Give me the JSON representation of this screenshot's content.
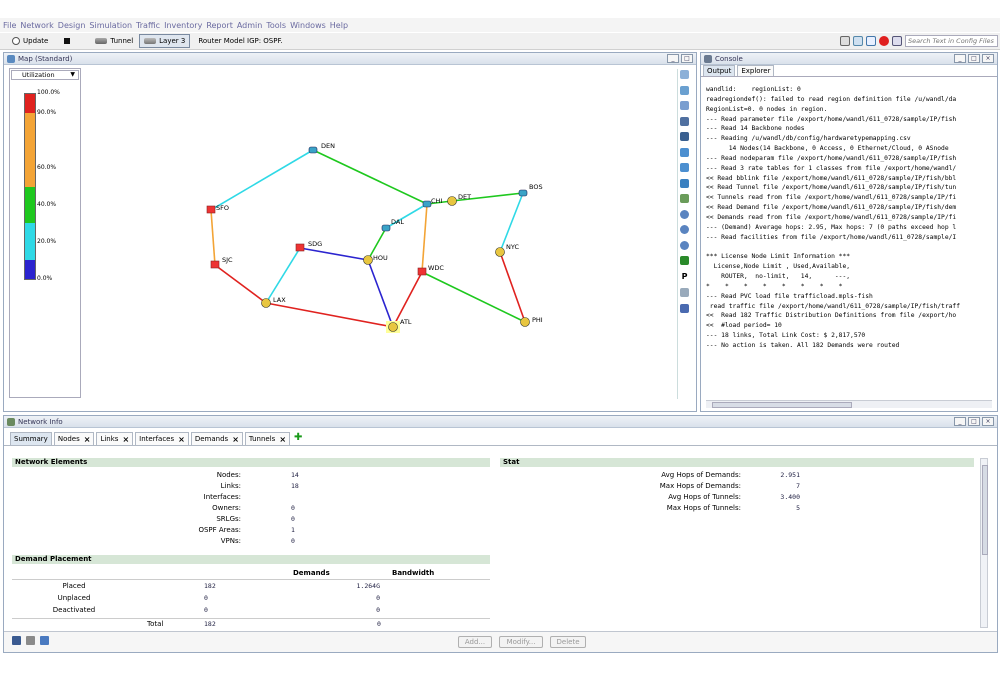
{
  "menu": [
    "File",
    "Network",
    "Design",
    "Simulation",
    "Traffic",
    "Inventory",
    "Report",
    "Admin",
    "Tools",
    "Windows",
    "Help"
  ],
  "toolbar": {
    "update": "Update",
    "tunnel": "Tunnel",
    "layer3": "Layer 3",
    "router_model": "Router Model IGP: OSPF.",
    "search_placeholder": "Search Text in Config Files"
  },
  "map": {
    "title": "Map (Standard)",
    "legend_select": "Utilization",
    "legend_ticks": [
      "100.0%",
      "90.0%",
      "60.0%",
      "40.0%",
      "20.0%",
      "0.0%"
    ],
    "nodes": {
      "DEN": "DEN",
      "SFO": "SFO",
      "SJC": "SJC",
      "LAX": "LAX",
      "SDG": "SDG",
      "HOU": "HOU",
      "DAL": "DAL",
      "CHI": "CHI",
      "DET": "DET",
      "BOS": "BOS",
      "NYC": "NYC",
      "WDC": "WDC",
      "ATL": "ATL",
      "PHI": "PHI"
    }
  },
  "console": {
    "title": "Console",
    "tabs": [
      "Output",
      "Explorer"
    ],
    "lines": [
      "wandlid:    regionList: 0",
      "readregiondef(): failed to read region definition file /u/wandl/da",
      "RegionList=0. 0 nodes in region.",
      "--- Read parameter file /export/home/wandl/611_0728/sample/IP/fish",
      "--- Read 14 Backbone nodes",
      "--- Reading /u/wandl/db/config/hardwaretypemapping.csv",
      "      14 Nodes(14 Backbone, 0 Access, 0 Ethernet/Cloud, 0 ASnode",
      "--- Read nodeparam file /export/home/wandl/611_0728/sample/IP/fish",
      "--- Read 3 rate tables for 1 classes from file /export/home/wandl/",
      "<< Read bblink file /export/home/wandl/611_0728/sample/IP/fish/bbl",
      "<< Read Tunnel file /export/home/wandl/611_0728/sample/IP/fish/tun",
      "<< Tunnels read from file /export/home/wandl/611_0728/sample/IP/fi",
      "<< Read Demand file /export/home/wandl/611_0728/sample/IP/fish/dem",
      "<< Demands read from file /export/home/wandl/611_0728/sample/IP/fi",
      "--- (Demand) Average hops: 2.95, Max hops: 7 (0 paths exceed hop l",
      "--- Read facilities from file /export/home/wandl/611_0728/sample/I",
      "",
      "*** License Node Limit Information ***",
      "  License,Node Limit , Used,Available,",
      "    ROUTER,  no-limit,   14,      ---,",
      "*    *    *    *    *    *    *    *",
      "--- Read PVC load file trafficload.mpls-fish",
      " read traffic file /export/home/wandl/611_0728/sample/IP/fish/traff",
      "<<  Read 182 Traffic Distribution Definitions from file /export/ho",
      "<<  #load period= 10",
      "--- 18 links, Total Link Cost: $ 2,817,570",
      "--- No action is taken. All 182 Demands were routed"
    ]
  },
  "network_info": {
    "title": "Network Info",
    "tabs": [
      "Summary",
      "Nodes",
      "Links",
      "Interfaces",
      "Demands",
      "Tunnels"
    ],
    "elements_title": "Network Elements",
    "elements": [
      {
        "label": "Nodes:",
        "value": "14"
      },
      {
        "label": "Links:",
        "value": "18"
      },
      {
        "label": "Interfaces:",
        "value": ""
      },
      {
        "label": "Owners:",
        "value": "0"
      },
      {
        "label": "SRLGs:",
        "value": "0"
      },
      {
        "label": "OSPF Areas:",
        "value": "1"
      },
      {
        "label": "VPNs:",
        "value": "0"
      }
    ],
    "stat_title": "Stat",
    "stats": [
      {
        "label": "Avg Hops of Demands:",
        "value": "2.951"
      },
      {
        "label": "Max Hops of Demands:",
        "value": "7"
      },
      {
        "label": "Avg Hops of Tunnels:",
        "value": "3.400"
      },
      {
        "label": "Max Hops of Tunnels:",
        "value": "5"
      }
    ],
    "placement_title": "Demand Placement",
    "placement_headers": [
      "Demands",
      "Bandwidth"
    ],
    "placement": [
      {
        "label": "Placed",
        "demands": "182",
        "bandwidth": "1.264G"
      },
      {
        "label": "Unplaced",
        "demands": "0",
        "bandwidth": "0"
      },
      {
        "label": "Deactivated",
        "demands": "0",
        "bandwidth": "0"
      }
    ],
    "total": {
      "label": "Total",
      "demands": "182",
      "bandwidth": "0"
    },
    "buttons": {
      "add": "Add...",
      "modify": "Modify...",
      "delete": "Delete"
    }
  }
}
